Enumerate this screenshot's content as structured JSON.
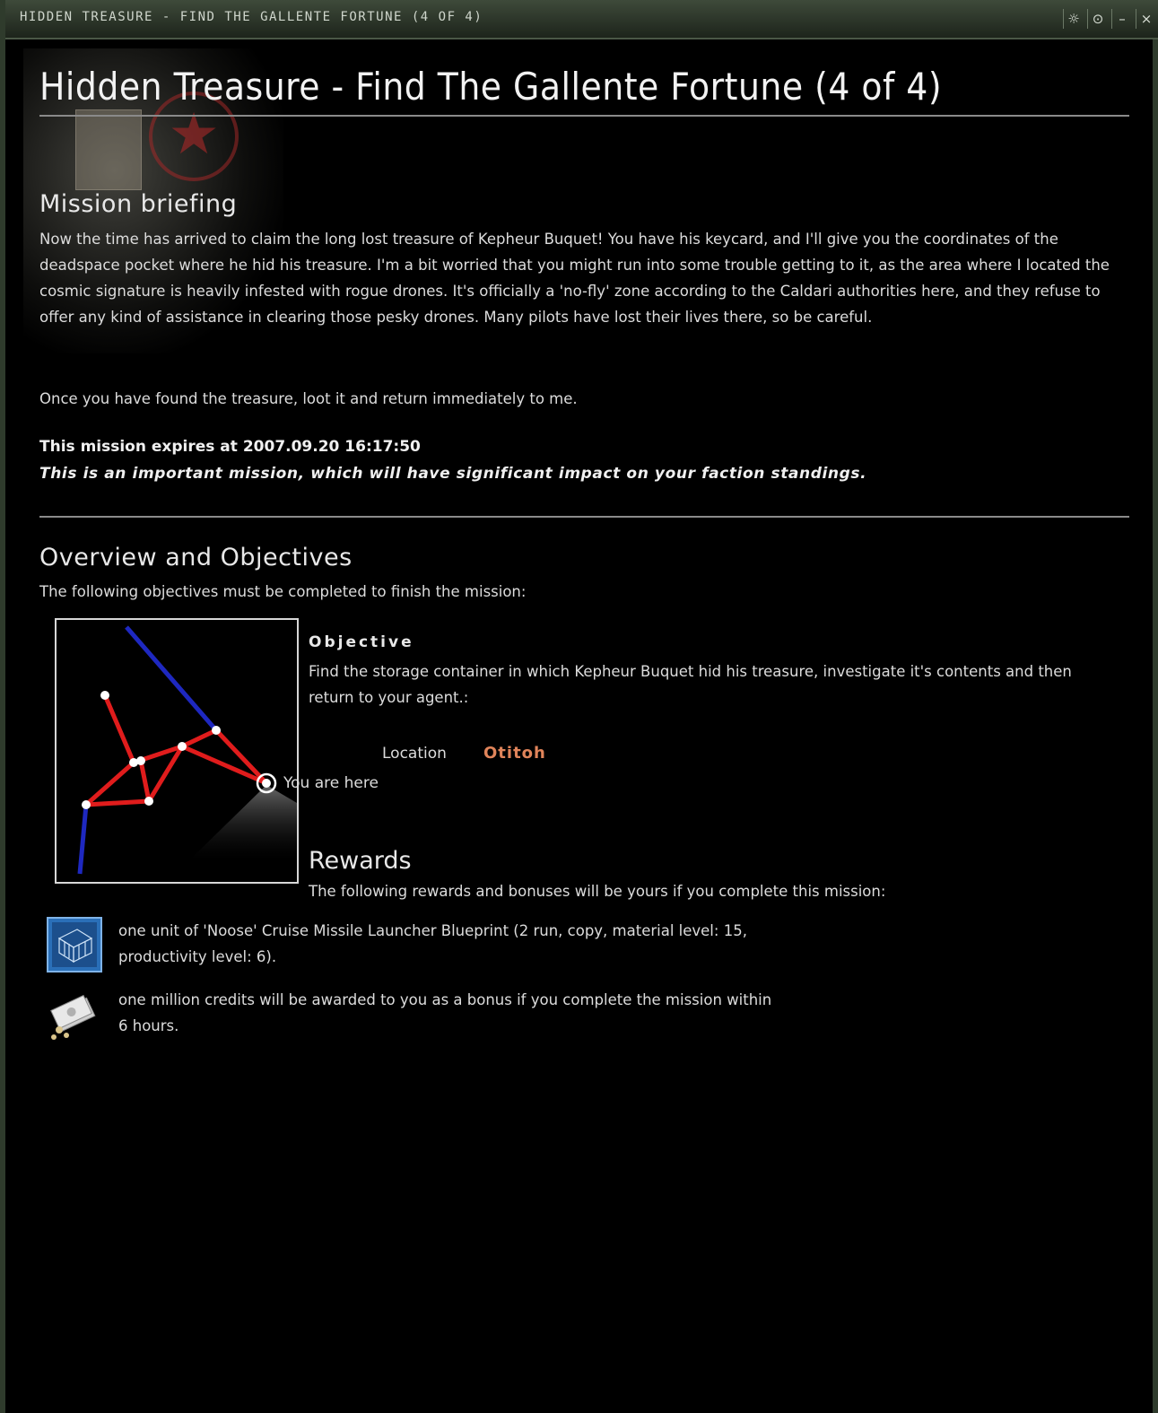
{
  "window": {
    "title": "HIDDEN TREASURE - FIND THE GALLENTE FORTUNE (4 OF 4)",
    "buttons": [
      "settings-icon",
      "pin-icon",
      "minimize-icon",
      "close-icon"
    ],
    "button_glyphs": [
      "☼",
      "⊙",
      "–",
      "×"
    ]
  },
  "mission": {
    "title": "Hidden Treasure - Find The Gallente Fortune (4 of 4)",
    "briefing_heading": "Mission briefing",
    "briefing_p1": "Now the time has arrived to claim the long lost treasure of Kepheur Buquet! You have his keycard, and I'll give you the coordinates of the deadspace pocket where he hid his treasure. I'm a bit worried that you might run into some trouble getting to it, as the area where I located the cosmic signature is heavily infested with rogue drones. It's officially a 'no-fly' zone according to the Caldari authorities here, and they refuse to offer any kind of assistance in clearing those pesky drones. Many pilots have lost their lives there, so be careful.",
    "briefing_p2": "Once you have found the treasure, loot it and return immediately to me.",
    "expires": "This mission expires at 2007.09.20 16:17:50",
    "important": "This is an important mission, which will have significant impact on your faction standings.",
    "overview_heading": "Overview and Objectives",
    "overview_text": "The following objectives must be completed to finish the mission:",
    "objective_title": "Objective",
    "objective_text": "Find the storage container in which Kepheur Buquet hid his treasure, investigate it's contents and then return to your agent.:",
    "location_label": "Location",
    "location_value": "Otitoh",
    "you_are_here": "You are here",
    "rewards_heading": "Rewards",
    "rewards_text": "The following rewards and bonuses will be yours if you complete this mission:",
    "reward_1": "one unit of 'Noose' Cruise Missile Launcher Blueprint (2 run, copy, material level: 15, productivity level: 6).",
    "reward_2": "one million credits will be awarded to you as a bonus if you complete the mission within 6 hours."
  },
  "colors": {
    "route": "#e02020",
    "route_other": "#2030c8",
    "location": "#e0845a"
  }
}
